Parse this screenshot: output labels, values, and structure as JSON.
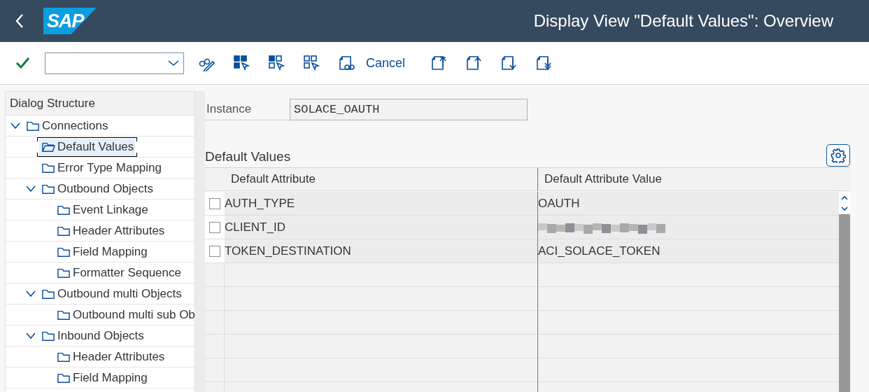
{
  "header": {
    "logo": "SAP",
    "title": "Display View \"Default Values\": Overview"
  },
  "toolbar": [
    {
      "kind": "confirm"
    },
    {
      "kind": "combo"
    },
    {
      "kind": "icon"
    },
    {
      "kind": "icon"
    },
    {
      "kind": "icon"
    },
    {
      "kind": "icon"
    },
    {
      "kind": "icon"
    },
    {
      "kind": "text",
      "label": "Cancel"
    },
    {
      "kind": "icon"
    },
    {
      "kind": "icon"
    },
    {
      "kind": "icon"
    },
    {
      "kind": "icon"
    }
  ],
  "dialog_structure": {
    "title": "Dialog Structure",
    "items": [
      {
        "label": "Connections",
        "expanded": true,
        "selected": false,
        "children": [
          {
            "label": "Default Values",
            "selected": true
          },
          {
            "label": "Error Type Mapping",
            "selected": false
          },
          {
            "label": "Outbound  Objects",
            "expanded": true,
            "selected": false,
            "children": [
              {
                "label": "Event Linkage",
                "selected": false
              },
              {
                "label": "Header Attributes",
                "selected": false
              },
              {
                "label": "Field Mapping",
                "selected": false
              },
              {
                "label": "Formatter Sequence",
                "selected": false
              }
            ]
          },
          {
            "label": "Outbound multi Objects",
            "expanded": true,
            "selected": false,
            "children": [
              {
                "label": "Outbound multi sub Ob",
                "selected": false
              }
            ]
          },
          {
            "label": "Inbound Objects",
            "expanded": true,
            "selected": false,
            "children": [
              {
                "label": "Header Attributes",
                "selected": false
              },
              {
                "label": "Field Mapping",
                "selected": false
              }
            ]
          }
        ]
      }
    ]
  },
  "instance": {
    "label": "Instance",
    "value": "SOLACE_OAUTH"
  },
  "table": {
    "title": "Default Values",
    "columns": [
      "Default Attribute",
      "Default Attribute Value"
    ],
    "rows": [
      {
        "attribute": "AUTH_TYPE",
        "kind": "text",
        "value": "OAUTH",
        "checked": false
      },
      {
        "attribute": "CLIENT_ID",
        "kind": "blurred",
        "checked": false
      },
      {
        "attribute": "TOKEN_DESTINATION",
        "kind": "text",
        "value": "ACI_SOLACE_TOKEN",
        "checked": false
      }
    ]
  }
}
